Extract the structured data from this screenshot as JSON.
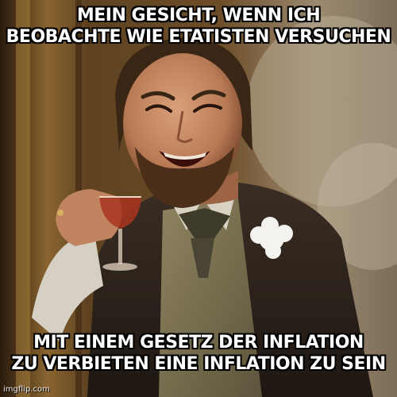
{
  "meme": {
    "top_caption": {
      "line1": "MEIN GESICHT, WENN ICH",
      "line2": "BEOBACHTE WIE ETATISTEN VERSUCHEN"
    },
    "bottom_caption": {
      "line1": "MIT EINEM GESETZ DER INFLATION",
      "line2": "ZU VERBIETEN EINE INFLATION ZU SEIN"
    },
    "watermark": "imgflip.com"
  },
  "colors": {
    "caption_text": "#ffffff",
    "caption_outline": "#000000",
    "background_warm": "#6b4a22"
  },
  "icons": {
    "photo": "laughing-man-with-glass-photo"
  }
}
